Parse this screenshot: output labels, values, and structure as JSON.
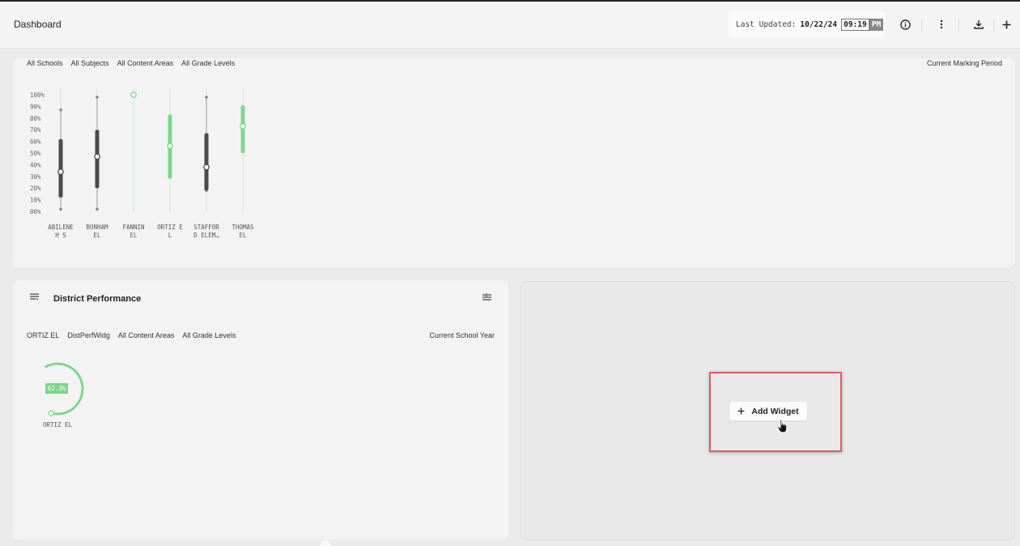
{
  "header": {
    "title": "Dashboard",
    "last_updated_label": "Last Updated:",
    "last_updated_date": "10/22/24",
    "last_updated_time": "09:19",
    "last_updated_ampm": "PM",
    "icons": [
      "info-icon",
      "more-vertical-icon",
      "download-icon",
      "plus-icon"
    ]
  },
  "widget1": {
    "filters": [
      "All Schools",
      "All Subjects",
      "All Content Areas",
      "All Grade Levels"
    ],
    "period": "Current Marking Period"
  },
  "chart_data": {
    "type": "box",
    "yticks": [
      "100%",
      "90%",
      "80%",
      "70%",
      "60%",
      "50%",
      "40%",
      "30%",
      "20%",
      "10%",
      "00%"
    ],
    "ylim": [
      0,
      100
    ],
    "categories": [
      {
        "line1": "ABILENE",
        "line2": "H S",
        "min": 2,
        "q1": 12,
        "median": 34,
        "q3": 62,
        "max": 87,
        "color": "#4a4a4a"
      },
      {
        "line1": "BONHAM",
        "line2": "EL",
        "min": 2,
        "q1": 20,
        "median": 47,
        "q3": 70,
        "max": 98,
        "color": "#4a4a4a"
      },
      {
        "line1": "FANNIN",
        "line2": "EL",
        "min": 100,
        "q1": 100,
        "median": 100,
        "q3": 100,
        "max": 100,
        "color": "#7fd68c"
      },
      {
        "line1": "ORTIZ E",
        "line2": "L",
        "min": 28,
        "q1": 28,
        "median": 56,
        "q3": 83,
        "max": 83,
        "color": "#7fd68c"
      },
      {
        "line1": "STAFFOR",
        "line2": "D ELEM…",
        "min": 18,
        "q1": 18,
        "median": 38,
        "q3": 67,
        "max": 98,
        "color": "#4a4a4a"
      },
      {
        "line1": "THOMAS",
        "line2": "EL",
        "min": 50,
        "q1": 50,
        "median": 73,
        "q3": 91,
        "max": 91,
        "color": "#7fd68c"
      }
    ]
  },
  "widget2": {
    "title": "District Performance",
    "filters": [
      "ORTIZ EL",
      "DistPerfWidg",
      "All Content Areas",
      "All Grade Levels"
    ],
    "period": "Current School Year",
    "donut": {
      "value_label": "62.3%",
      "value": 62.3,
      "name": "ORTIZ EL",
      "color": "#7fd68c"
    }
  },
  "widget3": {
    "add_label": "Add Widget"
  }
}
